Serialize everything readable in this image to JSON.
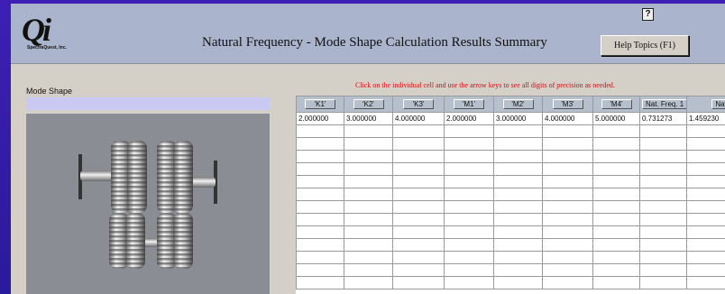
{
  "header": {
    "logo_letters": "Qi",
    "brand": "SpectraQuest, Inc.",
    "title": "Natural Frequency - Mode Shape Calculation Results Summary",
    "help_icon": "?",
    "help_button": "Help Topics (F1)"
  },
  "left": {
    "label": "Mode Shape"
  },
  "note": "Click on the individual cell and use the arrow keys to see all digits of precision as needed.",
  "table": {
    "columns": [
      "'K1'",
      "'K2'",
      "'K3'",
      "'M1'",
      "'M2'",
      "'M3'",
      "'M4'",
      "Nat. Freq. 1",
      "Nat. Freq"
    ],
    "rows": [
      [
        "2.000000",
        "3.000000",
        "4.000000",
        "2.000000",
        "3.000000",
        "4.000000",
        "5.000000",
        "0.731273",
        "1.459230"
      ]
    ]
  }
}
